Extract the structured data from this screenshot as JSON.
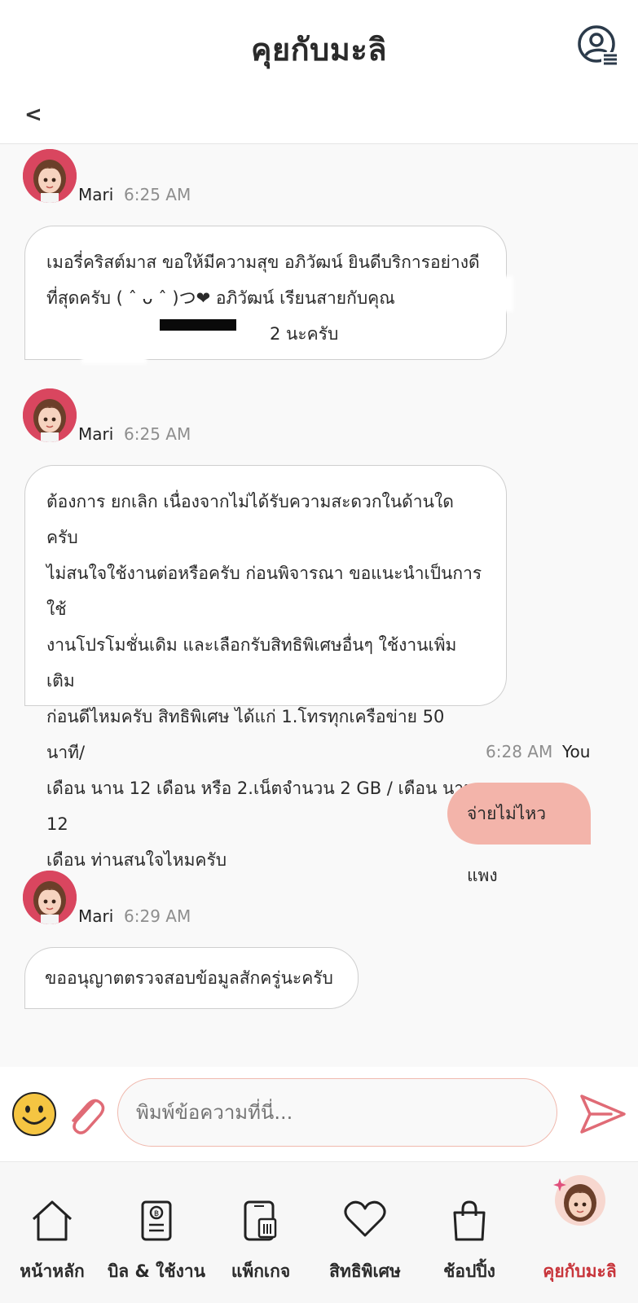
{
  "header": {
    "title": "คุยกับมะลิ",
    "back_label": "<"
  },
  "messages": [
    {
      "sender": "Mari",
      "time": "6:25 AM",
      "lines": [
        "เมอรี่คริสต์มาส ขอให้มีความสุข อภิวัฒน์ ยินดีบริการอย่างดี",
        "ที่สุดครับ ( ˆ ᴗ ˆ )つ❤ อภิวัฒน์ เรียนสายกับคุณ",
        "2 นะครับ"
      ]
    },
    {
      "sender": "Mari",
      "time": "6:25 AM",
      "lines": [
        "ต้องการ ยกเลิก เนื่องจากไม่ได้รับความสะดวกในด้านใดครับ",
        "ไม่สนใจใช้งานต่อหรือครับ ก่อนพิจารณา ขอแนะนำเป็นการใช้",
        "งานโปรโมชั่นเดิม และเลือกรับสิทธิพิเศษอื่นๆ ใช้งานเพิ่มเติม",
        "ก่อนดีไหมครับ สิทธิพิเศษ ได้แก่ 1.โทรทุกเครือข่าย 50 นาที/",
        "เดือน นาน 12 เดือน หรือ 2.เน็ตจำนวน 2 GB / เดือน นาน 12",
        "เดือน ท่านสนใจไหมครับ"
      ]
    },
    {
      "sender": "You",
      "time": "6:28 AM",
      "text": "จ่ายไม่ไหวแพง"
    },
    {
      "sender": "Mari",
      "time": "6:29 AM",
      "text": "ขออนุญาตตรวจสอบข้อมูลสักครู่นะครับ"
    }
  ],
  "composer": {
    "placeholder": "พิมพ์ข้อความที่นี่..."
  },
  "nav": [
    {
      "label": "หน้าหลัก",
      "icon": "home-icon"
    },
    {
      "label": "บิล & ใช้งาน",
      "icon": "bill-icon"
    },
    {
      "label": "แพ็กเกจ",
      "icon": "sim-package-icon"
    },
    {
      "label": "สิทธิพิเศษ",
      "icon": "heart-icon"
    },
    {
      "label": "ช้อปปิ้ง",
      "icon": "shopping-bag-icon"
    },
    {
      "label": "คุยกับมะลิ",
      "icon": "mari-avatar-icon",
      "active": true
    }
  ],
  "colors": {
    "accent": "#c8353b",
    "user_bubble": "#f3b4aa",
    "avatar_bg": "#d9465f"
  }
}
